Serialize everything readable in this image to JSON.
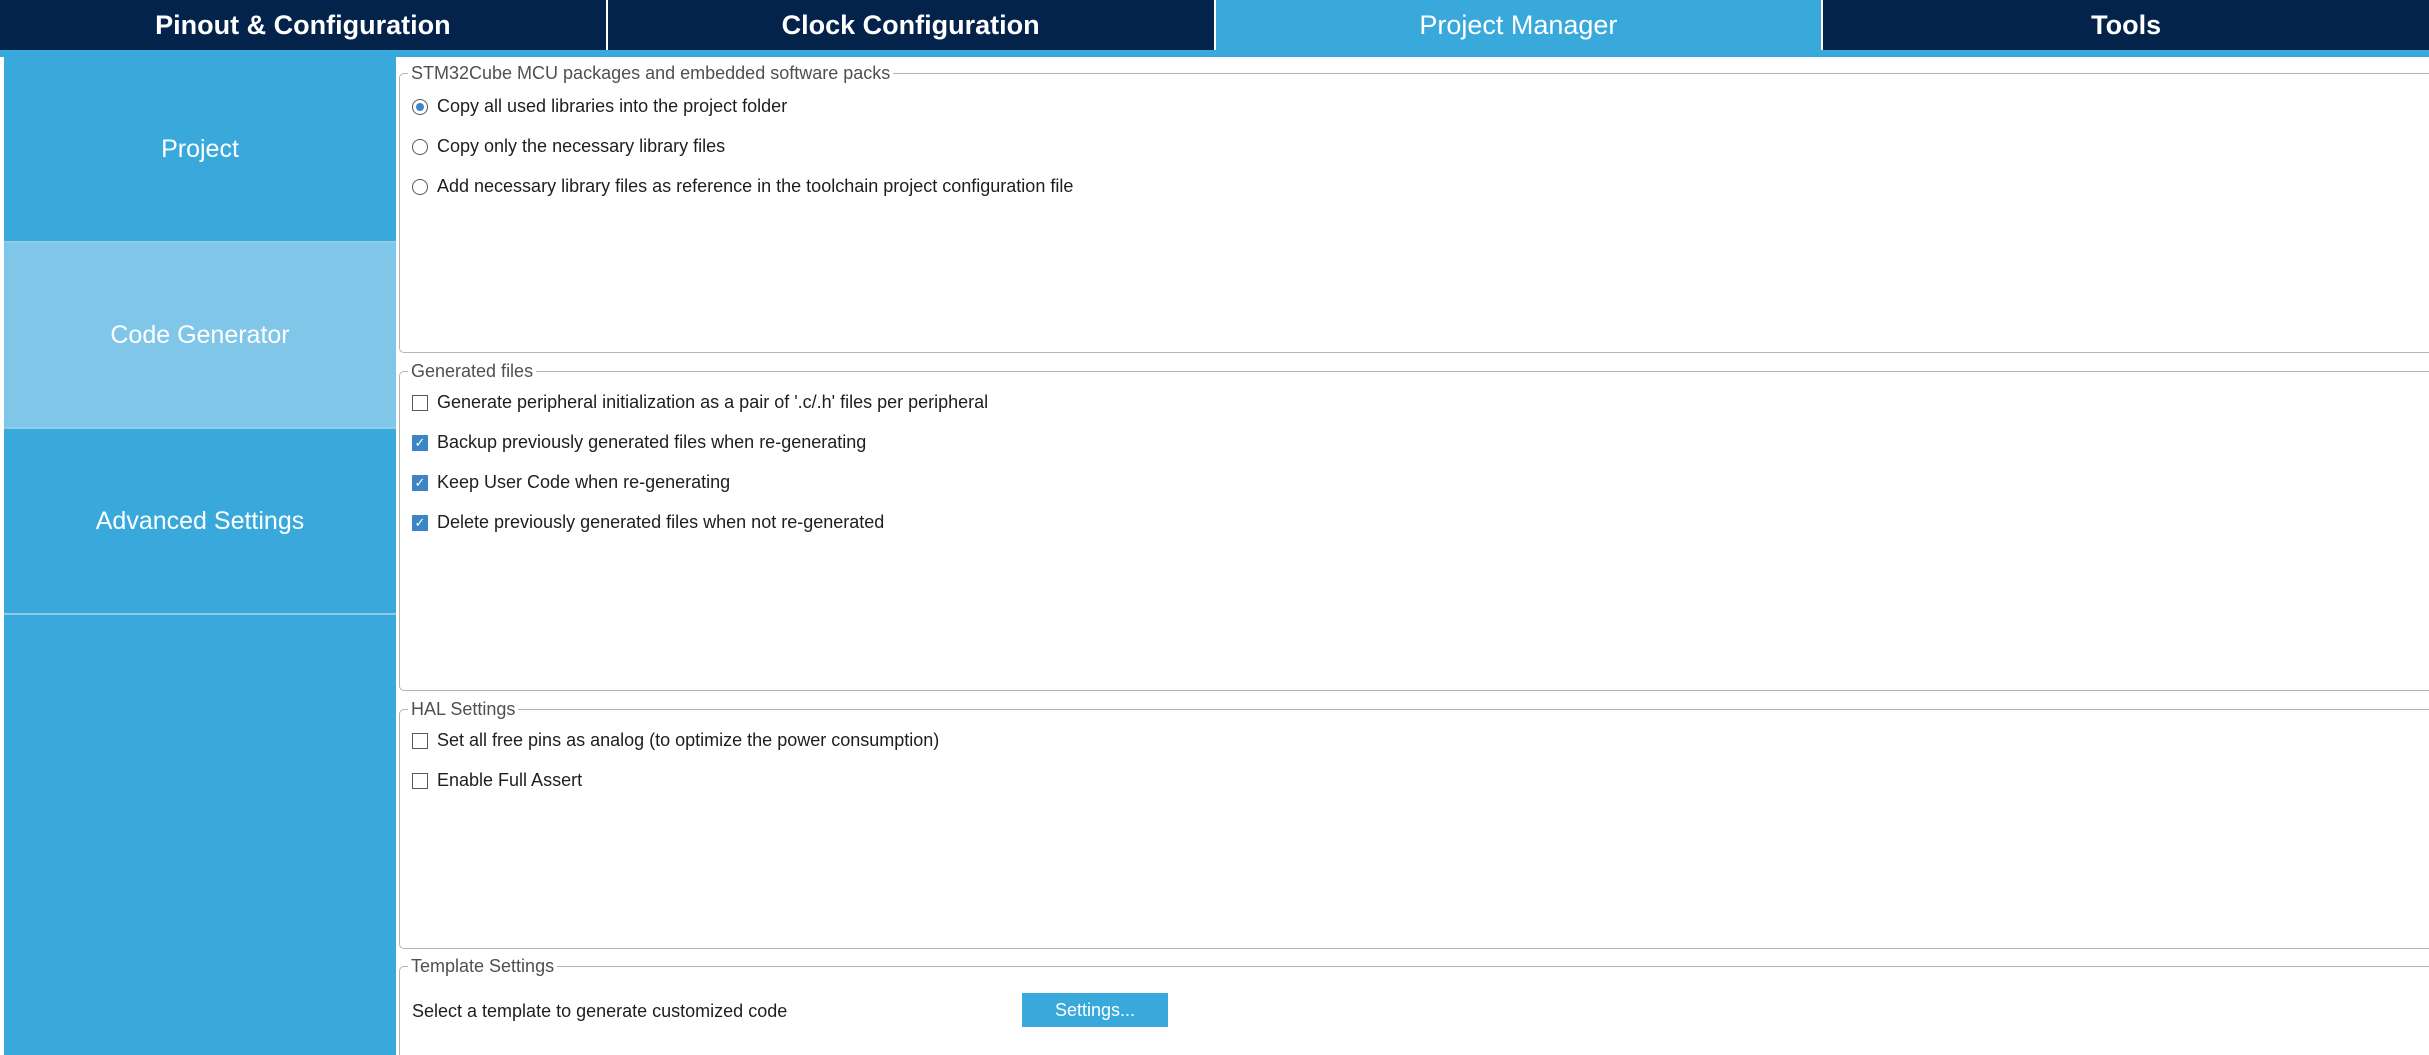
{
  "tabs": [
    {
      "label": "Pinout & Configuration"
    },
    {
      "label": "Clock Configuration"
    },
    {
      "label": "Project Manager"
    },
    {
      "label": "Tools"
    }
  ],
  "nav": [
    {
      "label": "Project"
    },
    {
      "label": "Code Generator"
    },
    {
      "label": "Advanced Settings"
    }
  ],
  "packages": {
    "legend": "STM32Cube MCU packages and embedded software packs",
    "options": [
      {
        "label": "Copy all used libraries into the project folder",
        "selected": true
      },
      {
        "label": "Copy only the necessary library files",
        "selected": false
      },
      {
        "label": "Add necessary library files as reference in the toolchain project configuration file",
        "selected": false
      }
    ]
  },
  "generated": {
    "legend": "Generated files",
    "options": [
      {
        "label": "Generate peripheral initialization as a pair of '.c/.h' files per peripheral",
        "checked": false
      },
      {
        "label": "Backup previously generated files when re-generating",
        "checked": true
      },
      {
        "label": "Keep User Code when re-generating",
        "checked": true
      },
      {
        "label": "Delete previously generated files when not re-generated",
        "checked": true
      }
    ]
  },
  "hal": {
    "legend": "HAL Settings",
    "options": [
      {
        "label": "Set all free pins as analog (to optimize the power consumption)",
        "checked": false
      },
      {
        "label": "Enable Full Assert",
        "checked": false
      }
    ]
  },
  "template": {
    "legend": "Template Settings",
    "text": "Select a template to generate customized code",
    "button": "Settings..."
  },
  "colors": {
    "dark_navy": "#03234b",
    "accent_blue": "#39a9dc",
    "selected_nav": "#7fc6e8",
    "check_blue": "#3d86c6"
  }
}
